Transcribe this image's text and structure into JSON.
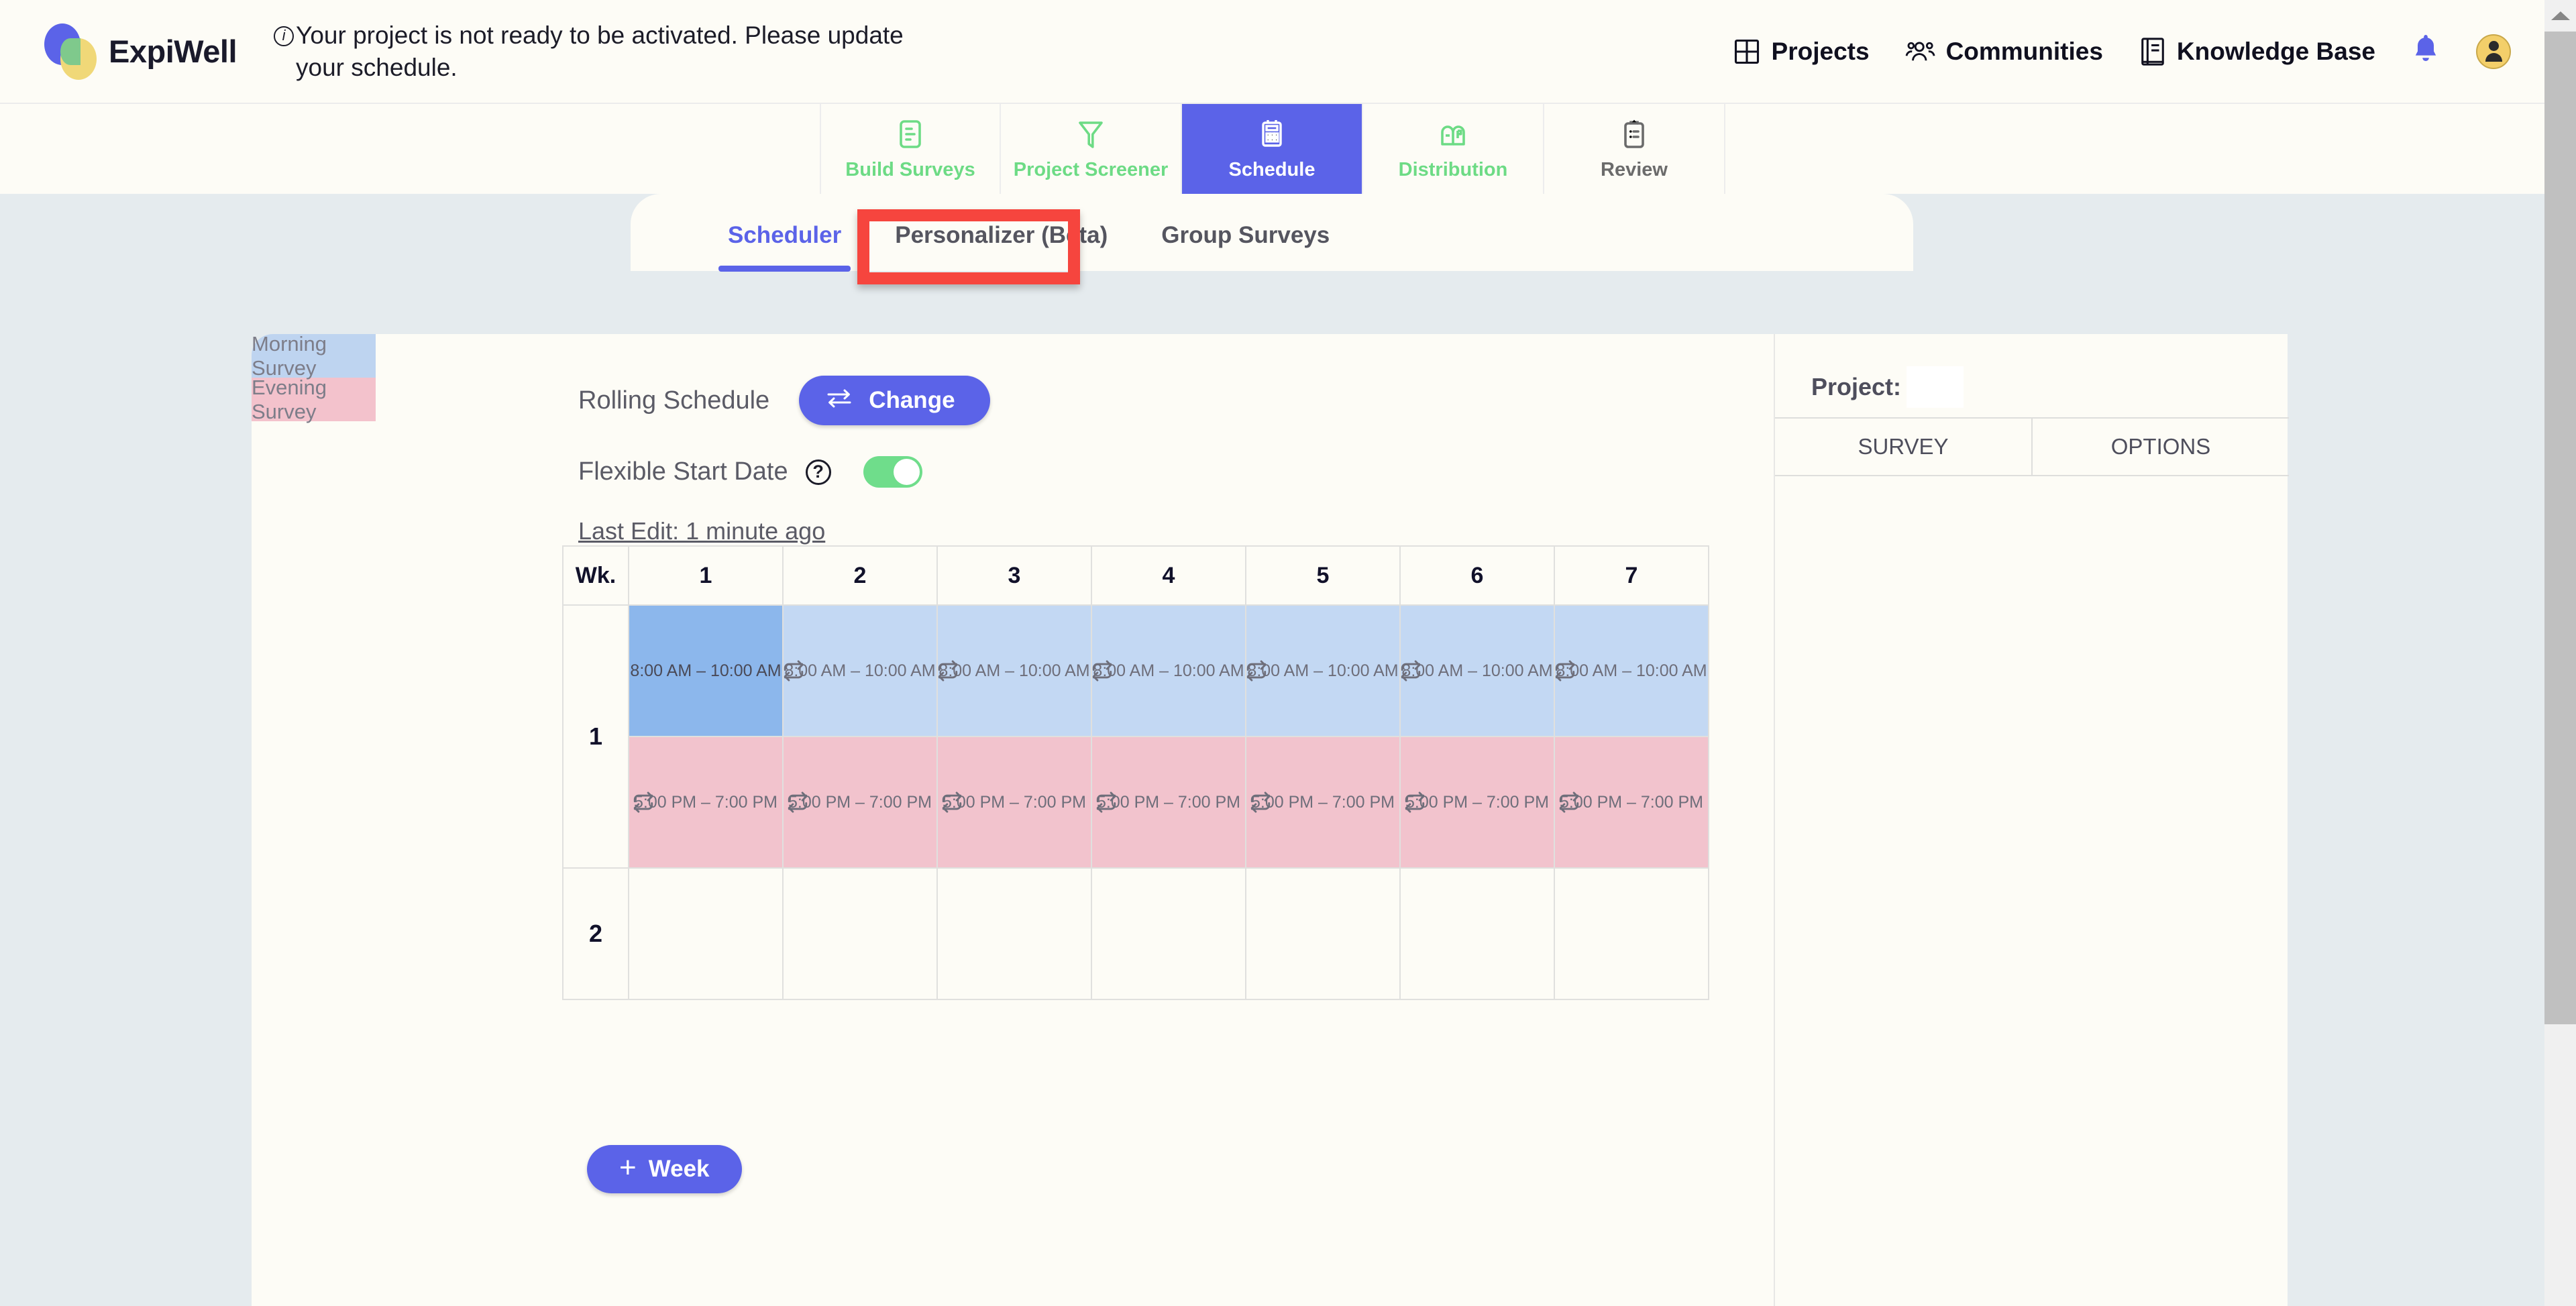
{
  "brand": {
    "name": "ExpiWell"
  },
  "alert": {
    "text": "Your project is not ready to be activated. Please update your schedule.",
    "icon": "info-icon"
  },
  "topnav": {
    "items": [
      {
        "label": "Projects",
        "icon": "grid-icon"
      },
      {
        "label": "Communities",
        "icon": "people-icon"
      },
      {
        "label": "Knowledge Base",
        "icon": "book-icon"
      }
    ],
    "notifications_icon": "bell-icon",
    "account_icon": "user-avatar-icon"
  },
  "steps": [
    {
      "label": "Build Surveys",
      "icon": "clipboard-list-icon",
      "state": "done"
    },
    {
      "label": "Project Screener",
      "icon": "funnel-icon",
      "state": "done"
    },
    {
      "label": "Schedule",
      "icon": "calculator-icon",
      "state": "active"
    },
    {
      "label": "Distribution",
      "icon": "mailbox-icon",
      "state": "done"
    },
    {
      "label": "Review",
      "icon": "clipboard-check-icon",
      "state": "todo"
    }
  ],
  "tabs": [
    {
      "label": "Scheduler",
      "active": true
    },
    {
      "label": "Personalizer (Beta)",
      "active": false,
      "highlighted": true
    },
    {
      "label": "Group Surveys",
      "active": false
    }
  ],
  "survey_tabs": [
    {
      "label": "Morning Survey",
      "color": "#bed4f0"
    },
    {
      "label": "Evening Survey",
      "color": "#f3c2cc"
    }
  ],
  "schedule": {
    "mode_label": "Rolling Schedule",
    "change_button": "Change",
    "change_icon": "swap-arrows-icon",
    "flexible_label": "Flexible Start Date",
    "help_icon": "question-mark-icon",
    "flexible_on": true,
    "last_edit": "Last Edit: 1 minute ago"
  },
  "calendar": {
    "week_header": "Wk.",
    "day_headers": [
      "1",
      "2",
      "3",
      "4",
      "5",
      "6",
      "7"
    ],
    "repeat_icon": "repeat-icon",
    "weeks": [
      {
        "number": "1",
        "rows": [
          {
            "survey": "Morning Survey",
            "type": "am",
            "cells": [
              {
                "time": "8:00 AM – 10:00 AM",
                "selected": true,
                "repeat": false
              },
              {
                "time": "8:00 AM – 10:00 AM",
                "selected": false,
                "repeat": true
              },
              {
                "time": "8:00 AM – 10:00 AM",
                "selected": false,
                "repeat": true
              },
              {
                "time": "8:00 AM – 10:00 AM",
                "selected": false,
                "repeat": true
              },
              {
                "time": "8:00 AM – 10:00 AM",
                "selected": false,
                "repeat": true
              },
              {
                "time": "8:00 AM – 10:00 AM",
                "selected": false,
                "repeat": true
              },
              {
                "time": "8:00 AM – 10:00 AM",
                "selected": false,
                "repeat": true
              }
            ]
          },
          {
            "survey": "Evening Survey",
            "type": "pm",
            "cells": [
              {
                "time": "5:00 PM – 7:00 PM",
                "selected": false,
                "repeat": true
              },
              {
                "time": "5:00 PM – 7:00 PM",
                "selected": false,
                "repeat": true
              },
              {
                "time": "5:00 PM – 7:00 PM",
                "selected": false,
                "repeat": true
              },
              {
                "time": "5:00 PM – 7:00 PM",
                "selected": false,
                "repeat": true
              },
              {
                "time": "5:00 PM – 7:00 PM",
                "selected": false,
                "repeat": true
              },
              {
                "time": "5:00 PM – 7:00 PM",
                "selected": false,
                "repeat": true
              },
              {
                "time": "5:00 PM – 7:00 PM",
                "selected": false,
                "repeat": true
              }
            ]
          }
        ]
      },
      {
        "number": "2",
        "rows": [
          {
            "survey": "Morning Survey",
            "type": "empty",
            "cells": [
              {},
              {},
              {},
              {},
              {},
              {},
              {}
            ]
          }
        ]
      }
    ]
  },
  "add_week_button": {
    "label": "Week",
    "plus": "+"
  },
  "right_panel": {
    "project_label": "Project:",
    "project_value": "",
    "tabs": [
      {
        "label": "SURVEY"
      },
      {
        "label": "OPTIONS"
      }
    ]
  },
  "colors": {
    "accent": "#5b63e8",
    "page_bg": "#e5ebee",
    "card_bg": "#fdfcf6",
    "morning": "#c3d8f3",
    "morning_selected": "#8cb7ec",
    "evening": "#f2c3cd",
    "done_green": "#6ddb85",
    "toggle_on": "#6fdd8b",
    "highlight_box": "#f6453e"
  }
}
